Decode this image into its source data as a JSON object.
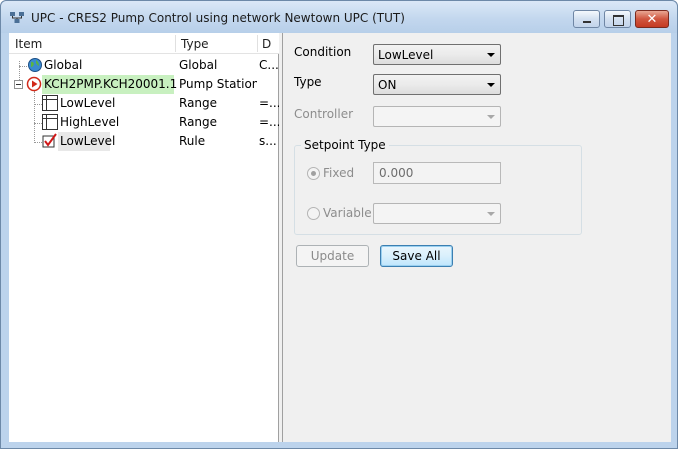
{
  "window": {
    "title": "UPC - CRES2 Pump Control  using network Newtown UPC (TUT)",
    "minimize_glyph": "",
    "maximize_glyph": "",
    "close_glyph": "✕"
  },
  "tree": {
    "columns": [
      "Item",
      "Type",
      "D"
    ],
    "rows": [
      {
        "item": "Global",
        "type": "Global",
        "d": "C...",
        "icon": "globe-icon"
      },
      {
        "item": "KCH2PMP.KCH20001.1",
        "type": "Pump Station",
        "d": "",
        "icon": "pump-station-icon"
      },
      {
        "item": "LowLevel",
        "type": "Range",
        "d": "=...",
        "icon": "range-icon"
      },
      {
        "item": "HighLevel",
        "type": "Range",
        "d": "=...",
        "icon": "range-icon"
      },
      {
        "item": "LowLevel",
        "type": "Rule",
        "d": "s...",
        "icon": "rule-icon"
      }
    ]
  },
  "form": {
    "condition_label": "Condition",
    "condition_value": "LowLevel",
    "type_label": "Type",
    "type_value": "ON",
    "controller_label": "Controller",
    "controller_value": "",
    "setpoint_group": "Setpoint Type",
    "fixed_label": "Fixed",
    "fixed_value": "0.000",
    "variable_label": "Variable",
    "variable_value": "",
    "update_button": "Update",
    "save_all_button": "Save All"
  },
  "colors": {
    "selected_row": "#c8f0c0",
    "titlebar": "#c3d7ee",
    "close_button": "#c43a22"
  }
}
